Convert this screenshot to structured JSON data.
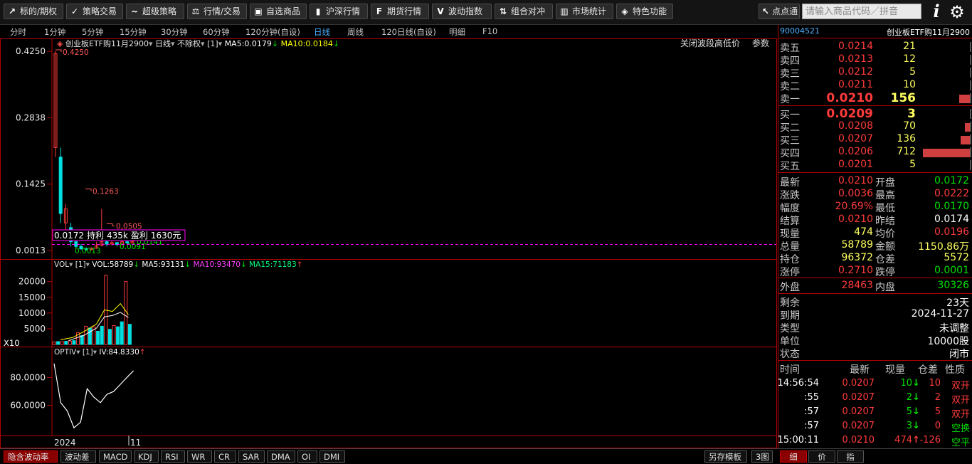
{
  "toolbar": {
    "buttons": [
      {
        "label": "标的/期权",
        "icon": "chart-line-icon"
      },
      {
        "label": "策略交易",
        "icon": "check-icon"
      },
      {
        "label": "超级策略",
        "icon": "wave-icon"
      },
      {
        "label": "行情/交易",
        "icon": "scale-icon"
      },
      {
        "label": "自选商品",
        "icon": "cart-icon"
      },
      {
        "label": "沪深行情",
        "icon": "bars-icon"
      },
      {
        "label": "期货行情",
        "icon": "f-letter-icon",
        "glyph": "F"
      },
      {
        "label": "波动指数",
        "icon": "v-letter-icon",
        "glyph": "V"
      },
      {
        "label": "组合对冲",
        "icon": "arrows-icon"
      },
      {
        "label": "市场统计",
        "icon": "stats-icon"
      },
      {
        "label": "特色功能",
        "icon": "cube-icon"
      }
    ],
    "point_btn": "点点通",
    "search_placeholder": "请输入商品代码／拼音"
  },
  "periods": [
    "分时",
    "1分钟",
    "5分钟",
    "15分钟",
    "30分钟",
    "60分钟",
    "120分钟(自设)",
    "日线",
    "周线",
    "120日线(自设)",
    "明细",
    "F10"
  ],
  "active_period": "日线",
  "main_chart": {
    "name": "创业板ETF购11月2900",
    "period": "日线",
    "adjust": "不除权",
    "param": "[1]",
    "ma5": "MA5:0.0179",
    "ma10": "MA10:0.0184",
    "close_label": "关闭波段高低价",
    "param_label": "参数",
    "y_ticks": [
      "0.4250",
      "0.2838",
      "0.1425",
      "0.0013"
    ],
    "peak_label": "0.4250",
    "mid_label": "0.1263",
    "label_0505": "0.0505",
    "label_0141": "0.0141",
    "label_0091": "0.0091",
    "low_label": "0.0013",
    "trade_info": [
      "0.0172",
      "持利",
      "435k",
      "盈利",
      "1630元"
    ]
  },
  "vol_chart": {
    "title": "VOL",
    "param": "[1]",
    "vol": "VOL:58789",
    "ma5": "MA5:93131",
    "ma10": "MA10:93470",
    "ma15": "MA15:71183",
    "y_ticks": [
      "20000",
      "15000",
      "10000",
      "5000"
    ],
    "unit": "X10"
  },
  "iv_chart": {
    "title": "OPTIV",
    "param": "[1]",
    "iv": "IV:84.8330",
    "y_ticks": [
      "80.0000",
      "60.0000"
    ]
  },
  "x_axis": {
    "year": "2024",
    "month": "11"
  },
  "chart_data": [
    {
      "type": "candlestick",
      "title": "创业板ETF购11月2900",
      "ylim": [
        0.0013,
        0.425
      ],
      "series": [
        {
          "name": "daily",
          "candles": [
            {
              "o": 0.22,
              "c": 0.42,
              "h": 0.425,
              "l": 0.2
            },
            {
              "o": 0.2,
              "c": 0.08,
              "h": 0.22,
              "l": 0.06
            },
            {
              "o": 0.06,
              "c": 0.09,
              "h": 0.1,
              "l": 0.04
            },
            {
              "o": 0.05,
              "c": 0.02,
              "h": 0.06,
              "l": 0.01
            },
            {
              "o": 0.02,
              "c": 0.01,
              "h": 0.03,
              "l": 0.005
            },
            {
              "o": 0.01,
              "c": 0.005,
              "h": 0.015,
              "l": 0.002
            },
            {
              "o": 0.005,
              "c": 0.003,
              "h": 0.008,
              "l": 0.0013
            },
            {
              "o": 0.003,
              "c": 0.006,
              "h": 0.008,
              "l": 0.002
            },
            {
              "o": 0.006,
              "c": 0.012,
              "h": 0.02,
              "l": 0.005
            },
            {
              "o": 0.012,
              "c": 0.02,
              "h": 0.09,
              "l": 0.01
            },
            {
              "o": 0.02,
              "c": 0.015,
              "h": 0.03,
              "l": 0.01
            },
            {
              "o": 0.015,
              "c": 0.018,
              "h": 0.03,
              "l": 0.012
            },
            {
              "o": 0.018,
              "c": 0.014,
              "h": 0.02,
              "l": 0.01
            },
            {
              "o": 0.014,
              "c": 0.02,
              "h": 0.05,
              "l": 0.012
            },
            {
              "o": 0.02,
              "c": 0.0172,
              "h": 0.025,
              "l": 0.0141
            },
            {
              "o": 0.0172,
              "c": 0.0209,
              "h": 0.0222,
              "l": 0.017
            }
          ]
        }
      ]
    },
    {
      "type": "bar",
      "title": "VOL",
      "ylim": [
        0,
        24000
      ],
      "values": [
        800,
        900,
        900,
        1000,
        1100,
        1200,
        3800,
        2800,
        5800,
        5200,
        5600,
        4200,
        5800,
        22000,
        4800,
        6000,
        5600,
        7200,
        20000,
        6400
      ]
    },
    {
      "type": "line",
      "title": "OPTIV",
      "ylim": [
        40,
        95
      ],
      "values": [
        90,
        62,
        56,
        44,
        48,
        72,
        66,
        62,
        68,
        70,
        75,
        80,
        84.833
      ]
    }
  ],
  "quote": {
    "code": "90004521",
    "name": "创业板ETF购11月2900",
    "asks": [
      {
        "label": "卖五",
        "price": "0.0214",
        "vol": "21",
        "bar": 0
      },
      {
        "label": "卖四",
        "price": "0.0213",
        "vol": "12",
        "bar": 0
      },
      {
        "label": "卖三",
        "price": "0.0212",
        "vol": "5",
        "bar": 0
      },
      {
        "label": "卖二",
        "price": "0.0211",
        "vol": "10",
        "bar": 0
      },
      {
        "label": "卖一",
        "price": "0.0210",
        "vol": "156",
        "bar": 0.22
      }
    ],
    "bids": [
      {
        "label": "买一",
        "price": "0.0209",
        "vol": "3",
        "bar": 0
      },
      {
        "label": "买二",
        "price": "0.0208",
        "vol": "70",
        "bar": 0.1
      },
      {
        "label": "买三",
        "price": "0.0207",
        "vol": "136",
        "bar": 0.19
      },
      {
        "label": "买四",
        "price": "0.0206",
        "vol": "712",
        "bar": 1.0
      },
      {
        "label": "买五",
        "price": "0.0201",
        "vol": "5",
        "bar": 0
      }
    ],
    "stats": [
      {
        "l1": "最新",
        "v1": "0.0210",
        "c1": "red",
        "l2": "开盘",
        "v2": "0.0172",
        "c2": "green"
      },
      {
        "l1": "涨跌",
        "v1": "0.0036",
        "c1": "red",
        "l2": "最高",
        "v2": "0.0222",
        "c2": "red"
      },
      {
        "l1": "幅度",
        "v1": "20.69%",
        "c1": "red",
        "l2": "最低",
        "v2": "0.0170",
        "c2": "green"
      },
      {
        "l1": "结算",
        "v1": "0.0210",
        "c1": "red",
        "l2": "昨结",
        "v2": "0.0174",
        "c2": "wht"
      },
      {
        "l1": "现量",
        "v1": "474",
        "c1": "yel",
        "l2": "均价",
        "v2": "0.0196",
        "c2": "red"
      },
      {
        "l1": "总量",
        "v1": "58789",
        "c1": "yel",
        "l2": "金额",
        "v2": "1150.86万",
        "c2": "yel"
      },
      {
        "l1": "持仓",
        "v1": "96372",
        "c1": "yel",
        "l2": "仓差",
        "v2": "5572",
        "c2": "yel"
      },
      {
        "l1": "涨停",
        "v1": "0.2710",
        "c1": "red",
        "l2": "跌停",
        "v2": "0.0001",
        "c2": "green"
      }
    ],
    "outer_label": "外盘",
    "outer": "28463",
    "inner_label": "内盘",
    "inner": "30326",
    "info": [
      {
        "l": "剩余",
        "v": "23天"
      },
      {
        "l": "到期",
        "v": "2024-11-27"
      },
      {
        "l": "类型",
        "v": "未调整"
      },
      {
        "l": "单位",
        "v": "10000股"
      },
      {
        "l": "状态",
        "v": "闭市"
      }
    ],
    "ticks_header": [
      "时间",
      "最新",
      "现量",
      "仓差",
      "性质"
    ],
    "ticks": [
      {
        "t": "14:56:54",
        "p": "0.0207",
        "q": "10",
        "dir": "down",
        "d": "10",
        "n": "双开",
        "nc": "red"
      },
      {
        "t": ":55",
        "p": "0.0207",
        "q": "2",
        "dir": "down",
        "d": "2",
        "n": "双开",
        "nc": "red"
      },
      {
        "t": ":57",
        "p": "0.0207",
        "q": "5",
        "dir": "down",
        "d": "5",
        "n": "双开",
        "nc": "red"
      },
      {
        "t": ":57",
        "p": "0.0207",
        "q": "3",
        "dir": "down",
        "d": "0",
        "n": "空换",
        "nc": "green"
      },
      {
        "t": "15:00:11",
        "p": "0.0210",
        "q": "474",
        "dir": "up",
        "d": "-126",
        "n": "空平",
        "nc": "green"
      }
    ]
  },
  "bottom_tabs": [
    "隐含波动率",
    "波动差",
    "MACD",
    "KDJ",
    "RSI",
    "WR",
    "CR",
    "SAR",
    "DMA",
    "OI",
    "DMI"
  ],
  "bottom_right": [
    "另存模板",
    "3图"
  ],
  "right_tabs": [
    "细",
    "价",
    "指"
  ],
  "colors": {
    "up": "#ff3b3b",
    "down": "#00e0e0",
    "border": "#b00000",
    "ma5": "#ffffff",
    "ma10": "#ffff00",
    "ma15": "#ff00ff"
  }
}
